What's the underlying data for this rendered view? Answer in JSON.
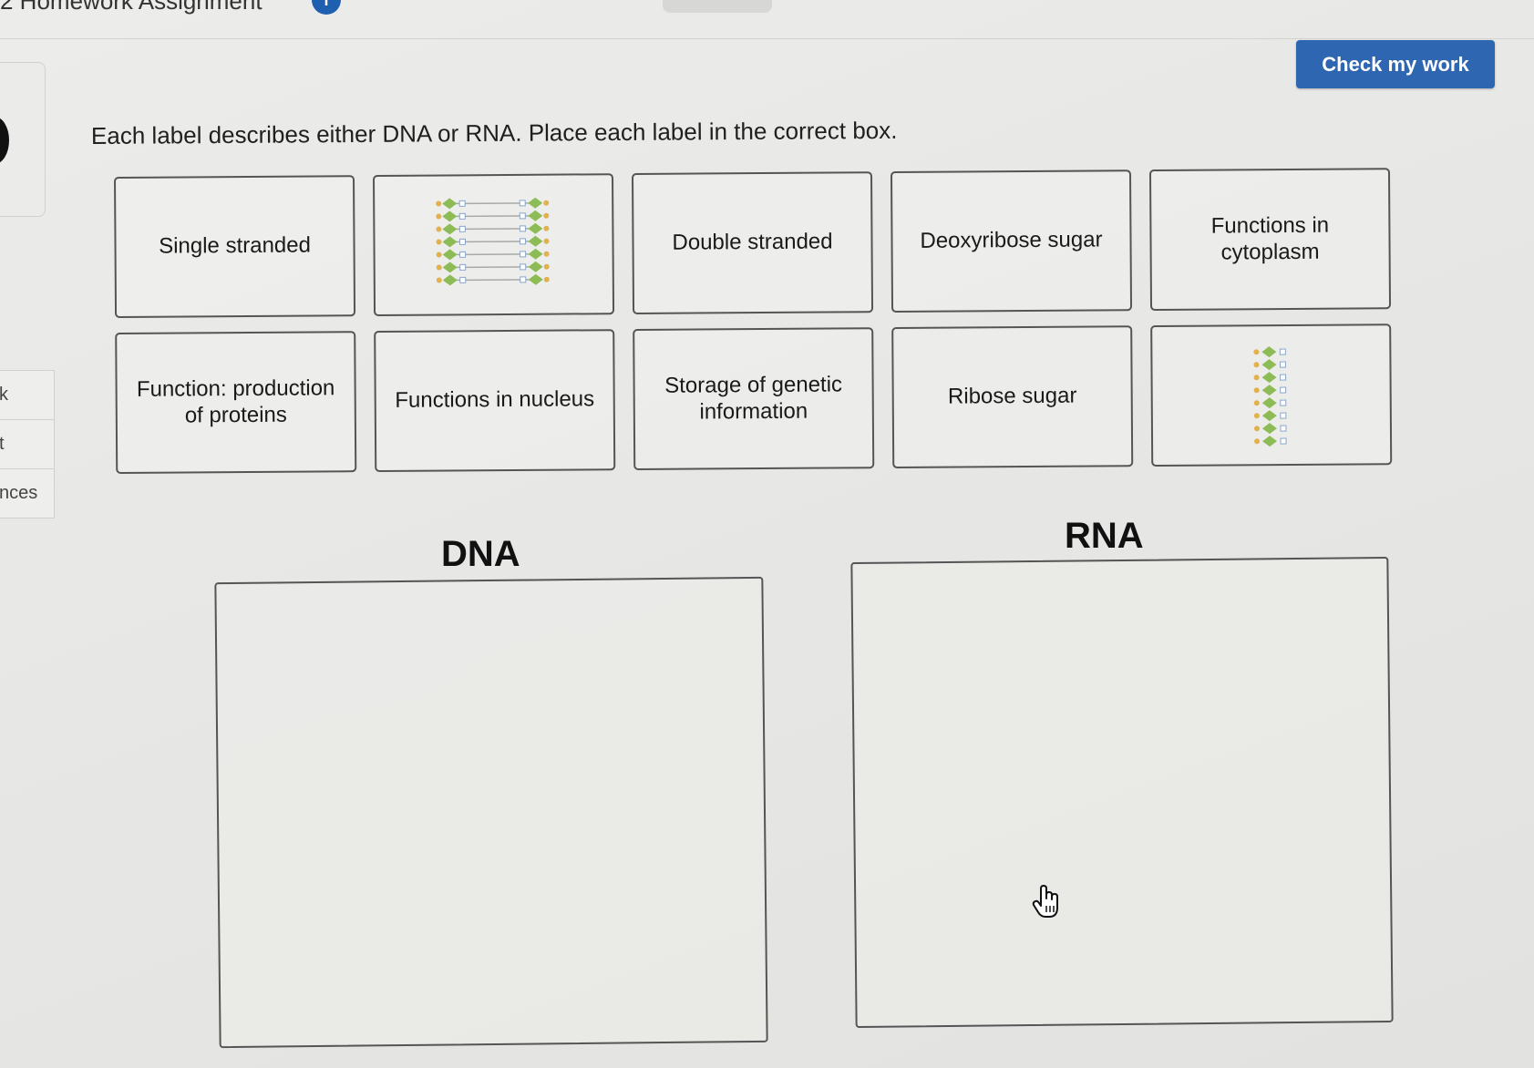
{
  "header": {
    "title": "2 Homework Assignment",
    "info_icon": "i"
  },
  "left_nav": {
    "items": [
      "k",
      "t",
      "nces"
    ]
  },
  "actions": {
    "check_label": "Check my work"
  },
  "question": {
    "instructions": "Each label describes either DNA or RNA.  Place each label in the correct box."
  },
  "labels": [
    {
      "type": "text",
      "lines": [
        "Single stranded"
      ]
    },
    {
      "type": "image",
      "icon": "double-helix-icon"
    },
    {
      "type": "text",
      "lines": [
        "Double stranded"
      ]
    },
    {
      "type": "text",
      "lines": [
        "Deoxyribose sugar"
      ]
    },
    {
      "type": "text",
      "lines": [
        "Functions in",
        "cytoplasm"
      ]
    },
    {
      "type": "text",
      "lines": [
        "Function: production",
        "of proteins"
      ]
    },
    {
      "type": "text",
      "lines": [
        "Functions in nucleus"
      ]
    },
    {
      "type": "text",
      "lines": [
        "Storage of genetic",
        "information"
      ]
    },
    {
      "type": "text",
      "lines": [
        "Ribose sugar"
      ]
    },
    {
      "type": "image",
      "icon": "single-strand-icon"
    }
  ],
  "drop_zones": {
    "dna_heading": "DNA",
    "rna_heading": "RNA"
  },
  "colors": {
    "button": "#2f66b2",
    "helix_green": "#8dbb55",
    "helix_orange": "#e2b04c"
  }
}
